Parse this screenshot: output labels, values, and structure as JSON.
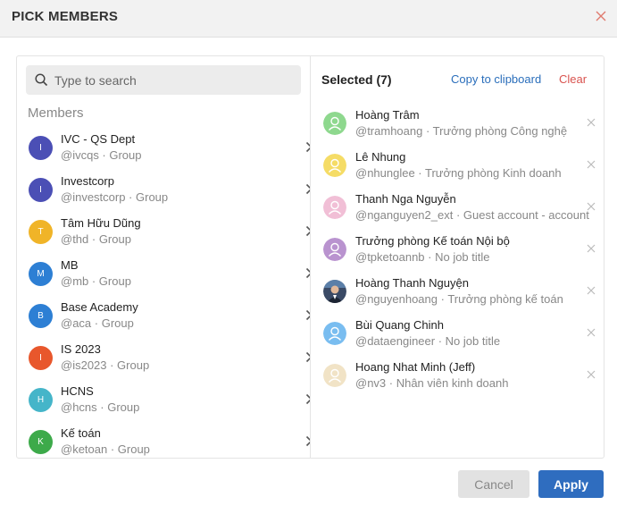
{
  "dialog": {
    "title": "PICK MEMBERS",
    "close_icon": "close-icon"
  },
  "search": {
    "placeholder": "Type to search",
    "value": ""
  },
  "groups": {
    "label": "Members",
    "items": [
      {
        "initial": "I",
        "name": "IVC - QS Dept",
        "sub": "@ivcqs · Group",
        "color": "#4b4fb5"
      },
      {
        "initial": "I",
        "name": "Investcorp",
        "sub": "@investcorp · Group",
        "color": "#4b4fb5"
      },
      {
        "initial": "T",
        "name": "Tâm Hữu Dũng",
        "sub": "@thd · Group",
        "color": "#f0b428"
      },
      {
        "initial": "M",
        "name": "MB",
        "sub": "@mb · Group",
        "color": "#2d7fd4"
      },
      {
        "initial": "B",
        "name": "Base Academy",
        "sub": "@aca · Group",
        "color": "#2d7fd4"
      },
      {
        "initial": "I",
        "name": "IS 2023",
        "sub": "@is2023 · Group",
        "color": "#e8572c"
      },
      {
        "initial": "H",
        "name": "HCNS",
        "sub": "@hcns · Group",
        "color": "#45b5c9"
      },
      {
        "initial": "K",
        "name": "Kế toán",
        "sub": "@ketoan · Group",
        "color": "#3daa4a"
      }
    ]
  },
  "selected": {
    "title": "Selected (7)",
    "copy_label": "Copy to clipboard",
    "clear_label": "Clear",
    "items": [
      {
        "name": "Hoàng Trâm",
        "sub": "@tramhoang · Trưởng phòng Công nghệ",
        "color": "#8ed88e",
        "photo": false
      },
      {
        "name": "Lê Nhung",
        "sub": "@nhunglee · Trưởng phòng Kinh doanh",
        "color": "#f5dc66",
        "photo": false
      },
      {
        "name": "Thanh Nga Nguyễn",
        "sub": "@nganguyen2_ext · Guest account - account",
        "color": "#f1bfd6",
        "photo": false
      },
      {
        "name": "Trưởng phòng Kế toán Nội bộ",
        "sub": "@tpketoannb · No job title",
        "color": "#b993cf",
        "photo": false
      },
      {
        "name": "Hoàng Thanh Nguyện",
        "sub": "@nguyenhoang · Trưởng phòng kế toán",
        "color": "#3a4a66",
        "photo": true
      },
      {
        "name": "Bùi Quang Chinh",
        "sub": "@dataengineer · No job title",
        "color": "#79bdf0",
        "photo": false
      },
      {
        "name": "Hoang Nhat Minh (Jeff)",
        "sub": "@nv3 · Nhân viên kinh doanh",
        "color": "#f1e3c6",
        "photo": false
      }
    ]
  },
  "footer": {
    "cancel_label": "Cancel",
    "apply_label": "Apply"
  }
}
